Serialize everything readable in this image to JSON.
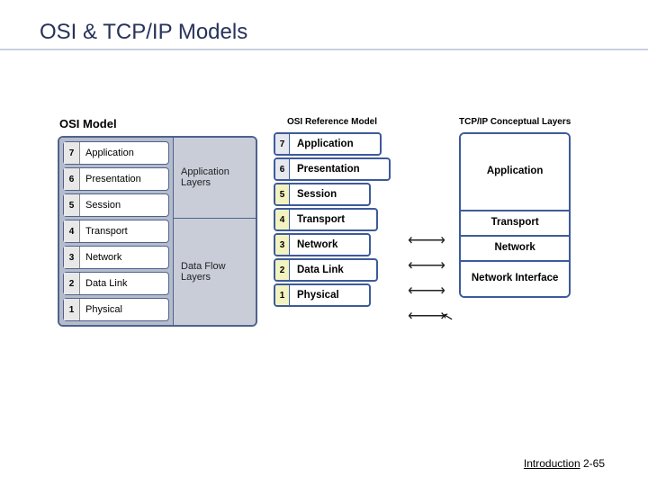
{
  "title": "OSI & TCP/IP Models",
  "left": {
    "header": "OSI Model",
    "layers": [
      {
        "n": "7",
        "name": "Application"
      },
      {
        "n": "6",
        "name": "Presentation"
      },
      {
        "n": "5",
        "name": "Session"
      },
      {
        "n": "4",
        "name": "Transport"
      },
      {
        "n": "3",
        "name": "Network"
      },
      {
        "n": "2",
        "name": "Data Link"
      },
      {
        "n": "1",
        "name": "Physical"
      }
    ],
    "groups": {
      "top": "Application Layers",
      "bottom": "Data Flow Layers"
    }
  },
  "mid": {
    "header": "OSI Reference Model",
    "layers": [
      {
        "n": "7",
        "name": "Application"
      },
      {
        "n": "6",
        "name": "Presentation"
      },
      {
        "n": "5",
        "name": "Session"
      },
      {
        "n": "4",
        "name": "Transport"
      },
      {
        "n": "3",
        "name": "Network"
      },
      {
        "n": "2",
        "name": "Data Link"
      },
      {
        "n": "1",
        "name": "Physical"
      }
    ]
  },
  "right": {
    "header": "TCP/IP Conceptual Layers",
    "layers": [
      "Application",
      "Transport",
      "Network",
      "Network Interface"
    ]
  },
  "arrow_glyph": "⟵⟶",
  "footer": {
    "chapter": "Introduction",
    "page": "2-65"
  }
}
